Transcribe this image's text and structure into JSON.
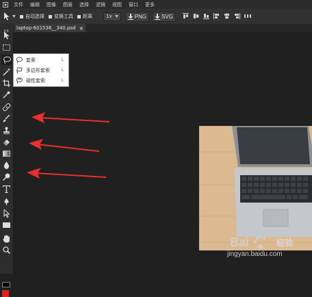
{
  "menu": {
    "items": [
      "文件",
      "编辑",
      "图像",
      "图层",
      "选择",
      "滤镜",
      "视图",
      "窗口",
      "更多"
    ]
  },
  "options": {
    "auto_select": "自动选择",
    "transform_tools": "变换工具",
    "distance": "距离",
    "zoom": "1x",
    "png": "PNG",
    "svg": "SVG"
  },
  "tab": {
    "title": "laptop-601536__340.psd",
    "close": "×"
  },
  "popup": {
    "items": [
      {
        "label": "套索",
        "shortcut": "L"
      },
      {
        "label": "多边形套索",
        "shortcut": "L"
      },
      {
        "label": "磁性套索",
        "shortcut": "L"
      }
    ]
  },
  "watermark": {
    "url": "jingyan.baidu.com",
    "brand": "经验"
  },
  "colors": {
    "foreground": "#000000",
    "background": "#e02020",
    "arrow": "#e8302e",
    "wood": "#d9b48a"
  }
}
